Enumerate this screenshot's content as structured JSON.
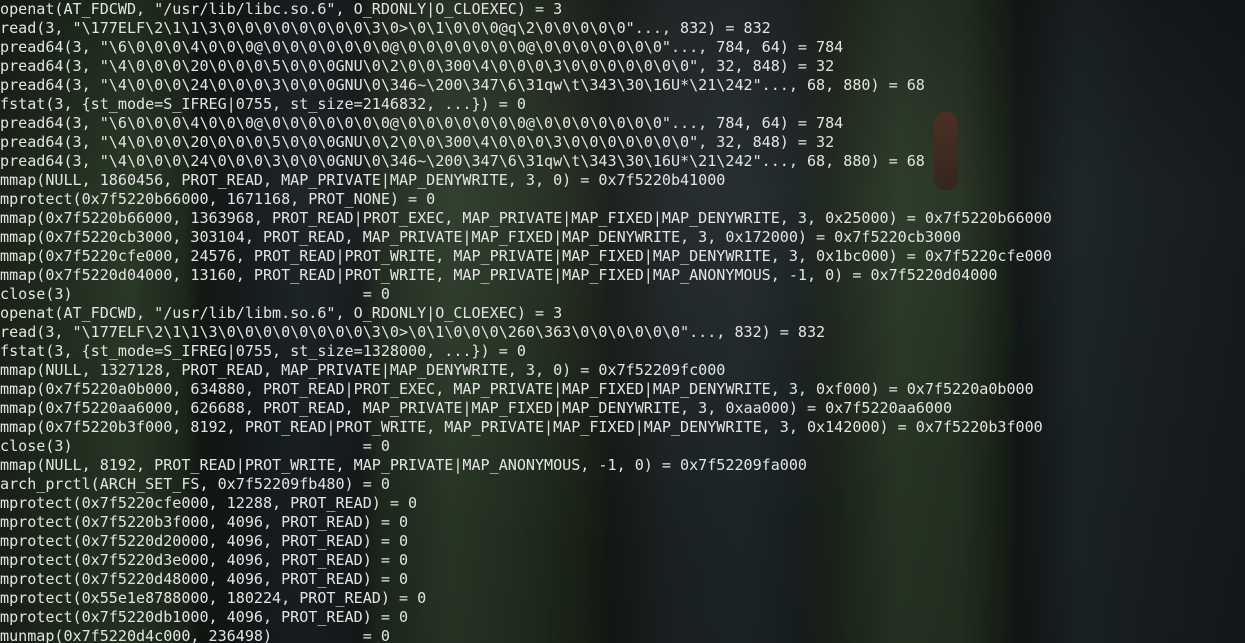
{
  "terminal": {
    "lines": [
      "openat(AT_FDCWD, \"/usr/lib/libc.so.6\", O_RDONLY|O_CLOEXEC) = 3",
      "read(3, \"\\177ELF\\2\\1\\1\\3\\0\\0\\0\\0\\0\\0\\0\\0\\3\\0>\\0\\1\\0\\0\\0@q\\2\\0\\0\\0\\0\\0\"..., 832) = 832",
      "pread64(3, \"\\6\\0\\0\\0\\4\\0\\0\\0@\\0\\0\\0\\0\\0\\0\\0@\\0\\0\\0\\0\\0\\0\\0@\\0\\0\\0\\0\\0\\0\\0\"..., 784, 64) = 784",
      "pread64(3, \"\\4\\0\\0\\0\\20\\0\\0\\0\\5\\0\\0\\0GNU\\0\\2\\0\\0\\300\\4\\0\\0\\0\\3\\0\\0\\0\\0\\0\\0\\0\", 32, 848) = 32",
      "pread64(3, \"\\4\\0\\0\\0\\24\\0\\0\\0\\3\\0\\0\\0GNU\\0\\346~\\200\\347\\6\\31qw\\t\\343\\30\\16U*\\21\\242\"..., 68, 880) = 68",
      "fstat(3, {st_mode=S_IFREG|0755, st_size=2146832, ...}) = 0",
      "pread64(3, \"\\6\\0\\0\\0\\4\\0\\0\\0@\\0\\0\\0\\0\\0\\0\\0@\\0\\0\\0\\0\\0\\0\\0@\\0\\0\\0\\0\\0\\0\\0\"..., 784, 64) = 784",
      "pread64(3, \"\\4\\0\\0\\0\\20\\0\\0\\0\\5\\0\\0\\0GNU\\0\\2\\0\\0\\300\\4\\0\\0\\0\\3\\0\\0\\0\\0\\0\\0\\0\", 32, 848) = 32",
      "pread64(3, \"\\4\\0\\0\\0\\24\\0\\0\\0\\3\\0\\0\\0GNU\\0\\346~\\200\\347\\6\\31qw\\t\\343\\30\\16U*\\21\\242\"..., 68, 880) = 68",
      "mmap(NULL, 1860456, PROT_READ, MAP_PRIVATE|MAP_DENYWRITE, 3, 0) = 0x7f5220b41000",
      "mprotect(0x7f5220b66000, 1671168, PROT_NONE) = 0",
      "mmap(0x7f5220b66000, 1363968, PROT_READ|PROT_EXEC, MAP_PRIVATE|MAP_FIXED|MAP_DENYWRITE, 3, 0x25000) = 0x7f5220b66000",
      "mmap(0x7f5220cb3000, 303104, PROT_READ, MAP_PRIVATE|MAP_FIXED|MAP_DENYWRITE, 3, 0x172000) = 0x7f5220cb3000",
      "mmap(0x7f5220cfe000, 24576, PROT_READ|PROT_WRITE, MAP_PRIVATE|MAP_FIXED|MAP_DENYWRITE, 3, 0x1bc000) = 0x7f5220cfe000",
      "mmap(0x7f5220d04000, 13160, PROT_READ|PROT_WRITE, MAP_PRIVATE|MAP_FIXED|MAP_ANONYMOUS, -1, 0) = 0x7f5220d04000",
      "close(3)                                = 0",
      "openat(AT_FDCWD, \"/usr/lib/libm.so.6\", O_RDONLY|O_CLOEXEC) = 3",
      "read(3, \"\\177ELF\\2\\1\\1\\3\\0\\0\\0\\0\\0\\0\\0\\0\\3\\0>\\0\\1\\0\\0\\0\\260\\363\\0\\0\\0\\0\\0\\0\"..., 832) = 832",
      "fstat(3, {st_mode=S_IFREG|0755, st_size=1328000, ...}) = 0",
      "mmap(NULL, 1327128, PROT_READ, MAP_PRIVATE|MAP_DENYWRITE, 3, 0) = 0x7f52209fc000",
      "mmap(0x7f5220a0b000, 634880, PROT_READ|PROT_EXEC, MAP_PRIVATE|MAP_FIXED|MAP_DENYWRITE, 3, 0xf000) = 0x7f5220a0b000",
      "mmap(0x7f5220aa6000, 626688, PROT_READ, MAP_PRIVATE|MAP_FIXED|MAP_DENYWRITE, 3, 0xaa000) = 0x7f5220aa6000",
      "mmap(0x7f5220b3f000, 8192, PROT_READ|PROT_WRITE, MAP_PRIVATE|MAP_FIXED|MAP_DENYWRITE, 3, 0x142000) = 0x7f5220b3f000",
      "close(3)                                = 0",
      "mmap(NULL, 8192, PROT_READ|PROT_WRITE, MAP_PRIVATE|MAP_ANONYMOUS, -1, 0) = 0x7f52209fa000",
      "arch_prctl(ARCH_SET_FS, 0x7f52209fb480) = 0",
      "mprotect(0x7f5220cfe000, 12288, PROT_READ) = 0",
      "mprotect(0x7f5220b3f000, 4096, PROT_READ) = 0",
      "mprotect(0x7f5220d20000, 4096, PROT_READ) = 0",
      "mprotect(0x7f5220d3e000, 4096, PROT_READ) = 0",
      "mprotect(0x7f5220d48000, 4096, PROT_READ) = 0",
      "mprotect(0x55e1e8788000, 180224, PROT_READ) = 0",
      "mprotect(0x7f5220db1000, 4096, PROT_READ) = 0",
      "munmap(0x7f5220d4c000, 236498)          = 0"
    ]
  }
}
